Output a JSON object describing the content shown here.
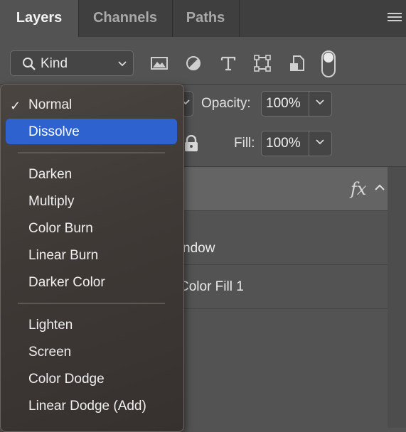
{
  "tabs": [
    {
      "label": "Layers",
      "active": true
    },
    {
      "label": "Channels",
      "active": false
    },
    {
      "label": "Paths",
      "active": false
    }
  ],
  "filter": {
    "kind_label": "Kind",
    "icons": [
      "image-filter-icon",
      "adjustment-filter-icon",
      "type-filter-icon",
      "shape-filter-icon",
      "smart-object-filter-icon",
      "filter-toggle"
    ]
  },
  "opacity": {
    "label": "Opacity:",
    "value": "100%"
  },
  "fill": {
    "label": "Fill:",
    "value": "100%"
  },
  "layers": {
    "fx_label": "fx",
    "rows": [
      {
        "name": "ndow"
      },
      {
        "name": "Color Fill 1"
      }
    ]
  },
  "blend_menu": {
    "selected": "Normal",
    "highlighted": "Dissolve",
    "check_mark": "✓",
    "groups": [
      [
        "Normal",
        "Dissolve"
      ],
      [
        "Darken",
        "Multiply",
        "Color Burn",
        "Linear Burn",
        "Darker Color"
      ],
      [
        "Lighten",
        "Screen",
        "Color Dodge",
        "Linear Dodge (Add)"
      ]
    ]
  },
  "colors": {
    "panel_bg": "#535353",
    "tab_bar_bg": "#3f3f3f",
    "menu_highlight": "#2d62cf"
  }
}
